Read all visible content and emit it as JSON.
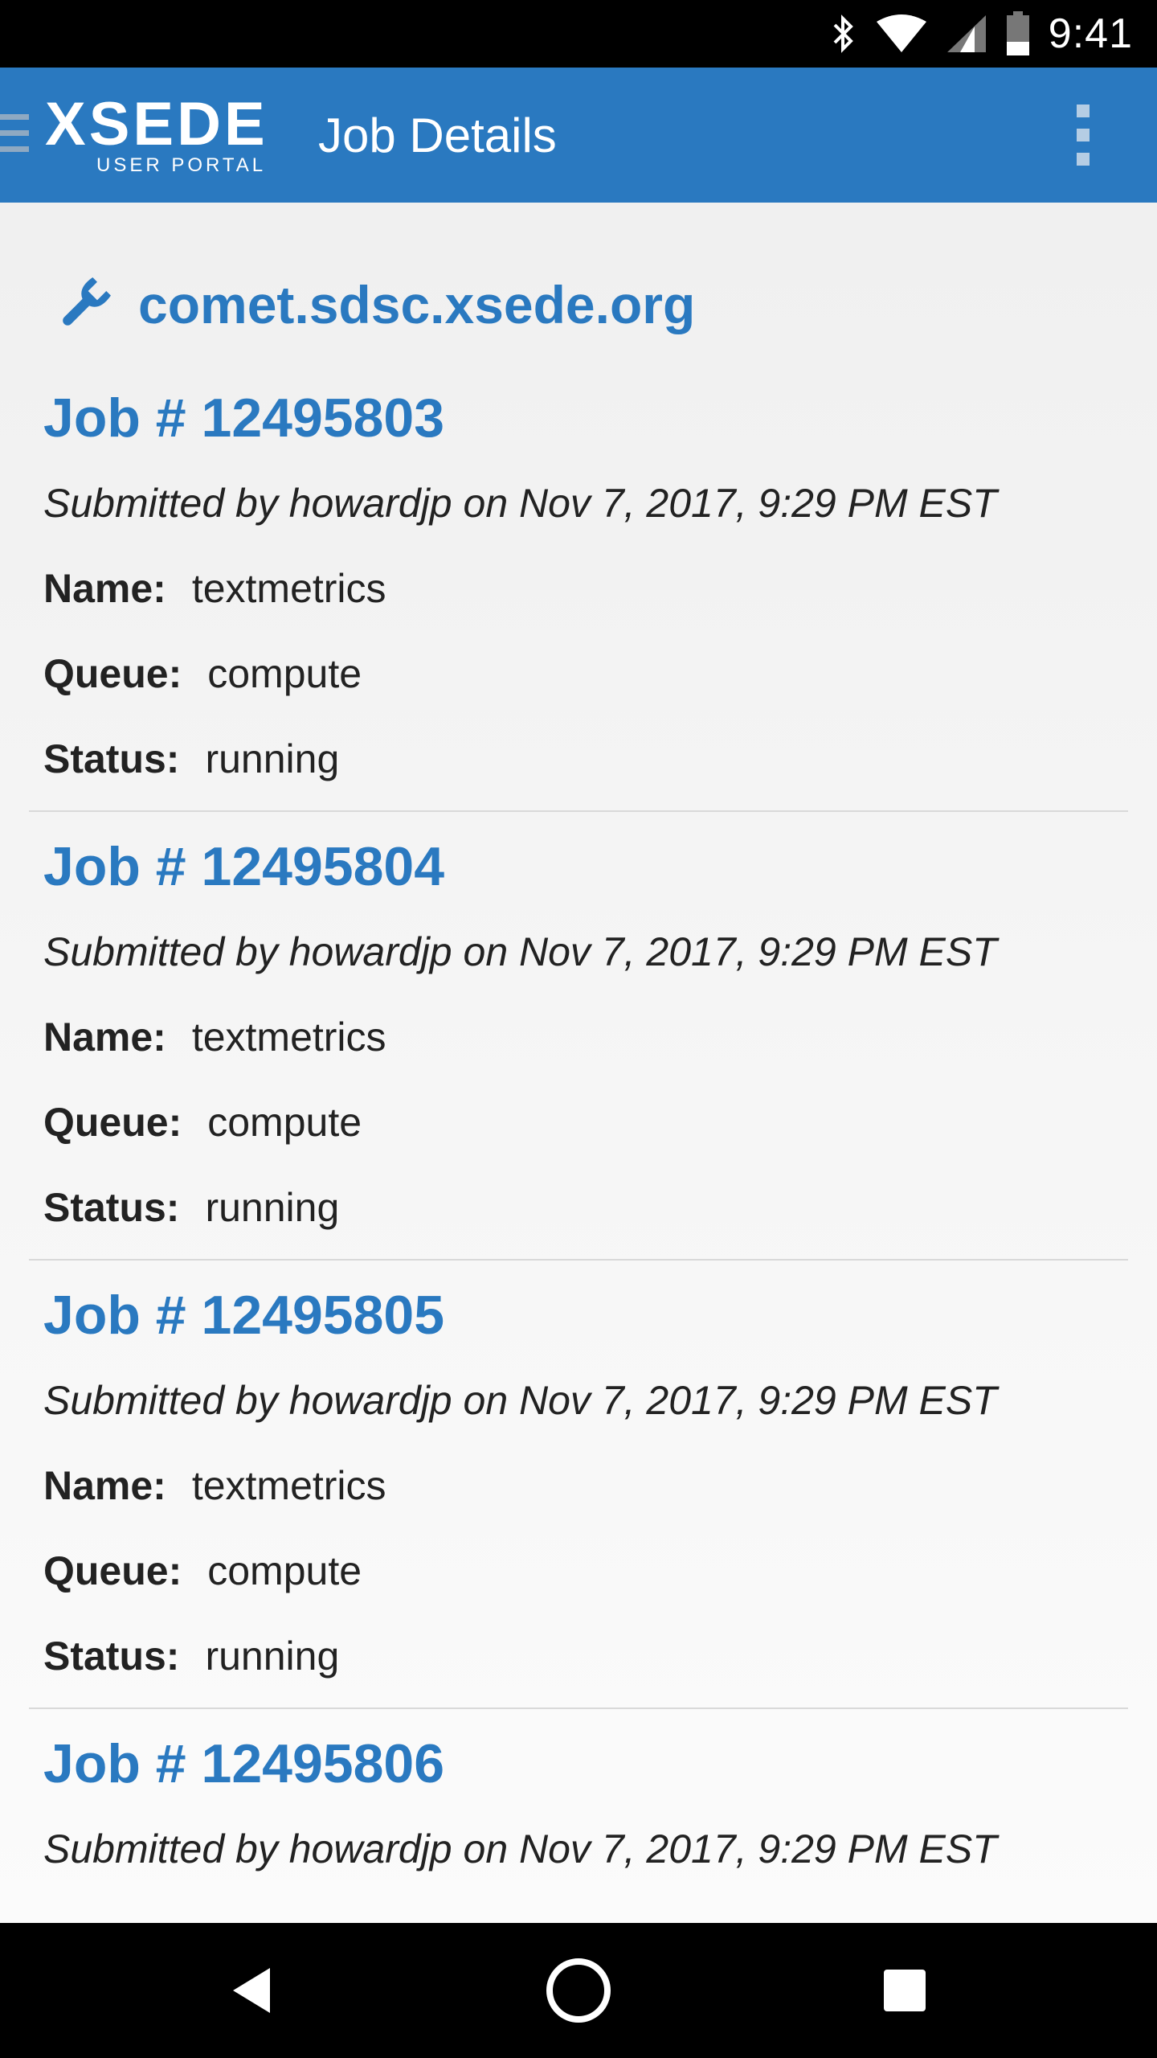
{
  "status_bar": {
    "time": "9:41",
    "icons": [
      "bluetooth-icon",
      "wifi-icon",
      "cell-signal-icon",
      "battery-icon"
    ]
  },
  "app_bar": {
    "logo_main": "XSEDE",
    "logo_sub": "USER PORTAL",
    "title": "Job Details",
    "accent_color": "#2a79c0"
  },
  "host": {
    "icon": "wrench-icon",
    "name": "comet.sdsc.xsede.org"
  },
  "labels": {
    "name": "Name:",
    "queue": "Queue:",
    "status": "Status:"
  },
  "jobs": [
    {
      "title": "Job # 12495803",
      "submitted": "Submitted by howardjp on Nov 7, 2017, 9:29 PM EST",
      "name": "textmetrics",
      "queue": "compute",
      "status": "running"
    },
    {
      "title": "Job # 12495804",
      "submitted": "Submitted by howardjp on Nov 7, 2017, 9:29 PM EST",
      "name": "textmetrics",
      "queue": "compute",
      "status": "running"
    },
    {
      "title": "Job # 12495805",
      "submitted": "Submitted by howardjp on Nov 7, 2017, 9:29 PM EST",
      "name": "textmetrics",
      "queue": "compute",
      "status": "running"
    },
    {
      "title": "Job # 12495806",
      "submitted": "Submitted by howardjp on Nov 7, 2017, 9:29 PM EST"
    }
  ],
  "nav_bar": {
    "icons": [
      "back-icon",
      "home-icon",
      "recents-icon"
    ]
  }
}
